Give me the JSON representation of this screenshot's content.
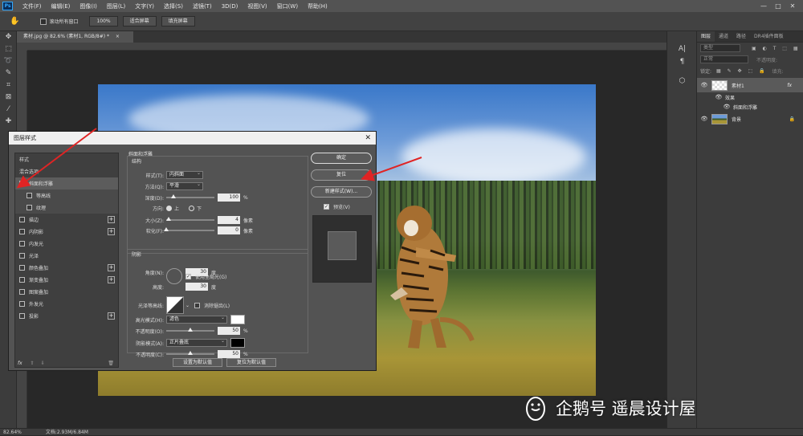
{
  "app": {
    "menu": [
      "文件(F)",
      "编辑(E)",
      "图像(I)",
      "图层(L)",
      "文字(Y)",
      "选择(S)",
      "滤镜(T)",
      "3D(D)",
      "视图(V)",
      "窗口(W)",
      "帮助(H)"
    ],
    "logo_text": "Ps",
    "window_controls": [
      "—",
      "□",
      "✕"
    ]
  },
  "options": {
    "scroll_all_label": "滚动所有窗口",
    "zoom_value": "100%",
    "fit_screen": "适合屏幕",
    "fill_screen": "填充屏幕"
  },
  "document": {
    "tab_title": "素材.jpg @ 82.6% (素材1, RGB/8#) *",
    "tab_close": "×"
  },
  "status": {
    "zoom": "82.64%",
    "doc_info": "文档:2.93M/6.84M"
  },
  "watermark": {
    "text": "企鹅号 遥晨设计屋"
  },
  "layers_panel": {
    "tabs": [
      "图层",
      "通道",
      "路径",
      "DR4插件面板"
    ],
    "filter_placeholder": "类型",
    "blend_mode": "正常",
    "opacity_label": "不透明度:",
    "lock_label": "锁定:",
    "fill_label": "填充:",
    "layers": [
      {
        "name": "素材1",
        "fx": "fx"
      },
      {
        "name": "效果"
      },
      {
        "name": "斜面和浮雕"
      },
      {
        "name": "背景"
      }
    ]
  },
  "dialog": {
    "title": "图层样式",
    "close": "✕",
    "style_header": "样式",
    "blend_options": "混合选项",
    "styles": [
      {
        "label": "斜面和浮雕",
        "checked": true,
        "selected": true,
        "plus": false
      },
      {
        "label": "等高线",
        "checked": false,
        "indent": true
      },
      {
        "label": "纹理",
        "checked": false,
        "indent": true
      },
      {
        "label": "描边",
        "checked": false,
        "plus": true
      },
      {
        "label": "内阴影",
        "checked": false,
        "plus": true
      },
      {
        "label": "内发光",
        "checked": false
      },
      {
        "label": "光泽",
        "checked": false
      },
      {
        "label": "颜色叠加",
        "checked": false,
        "plus": true
      },
      {
        "label": "渐变叠加",
        "checked": false,
        "plus": true
      },
      {
        "label": "图案叠加",
        "checked": false
      },
      {
        "label": "外发光",
        "checked": false
      },
      {
        "label": "投影",
        "checked": false,
        "plus": true
      }
    ],
    "fx_label": "fx",
    "bevel": {
      "section_title": "斜面和浮雕",
      "structure_title": "结构",
      "style_label": "样式(T):",
      "style_value": "内斜面",
      "technique_label": "方法(Q):",
      "technique_value": "平滑",
      "depth_label": "深度(D):",
      "depth_value": "100",
      "depth_unit": "%",
      "direction_label": "方向:",
      "dir_up": "上",
      "dir_down": "下",
      "size_label": "大小(Z):",
      "size_value": "4",
      "size_unit": "像素",
      "soften_label": "软化(F):",
      "soften_value": "0",
      "soften_unit": "像素",
      "shading_title": "阴影",
      "angle_label": "角度(N):",
      "angle_value": "30",
      "angle_unit": "度",
      "global_light": "使用全局光(G)",
      "altitude_label": "高度:",
      "altitude_value": "30",
      "altitude_unit": "度",
      "gloss_label": "光泽等高线:",
      "anti_alias": "消除锯齿(L)",
      "highlight_label": "高光模式(H):",
      "highlight_mode": "滤色",
      "hl_opacity_label": "不透明度(O):",
      "hl_opacity_value": "50",
      "shadow_label": "阴影模式(A):",
      "shadow_mode": "正片叠底",
      "sh_opacity_label": "不透明度(C):",
      "sh_opacity_value": "50",
      "percent": "%",
      "make_default": "设置为默认值",
      "reset_default": "复位为默认值"
    },
    "buttons": {
      "ok": "确定",
      "reset": "复位",
      "new_style": "新建样式(W)...",
      "preview": "预览(V)"
    },
    "colors": {
      "highlight": "#ffffff",
      "shadow": "#000000"
    }
  }
}
